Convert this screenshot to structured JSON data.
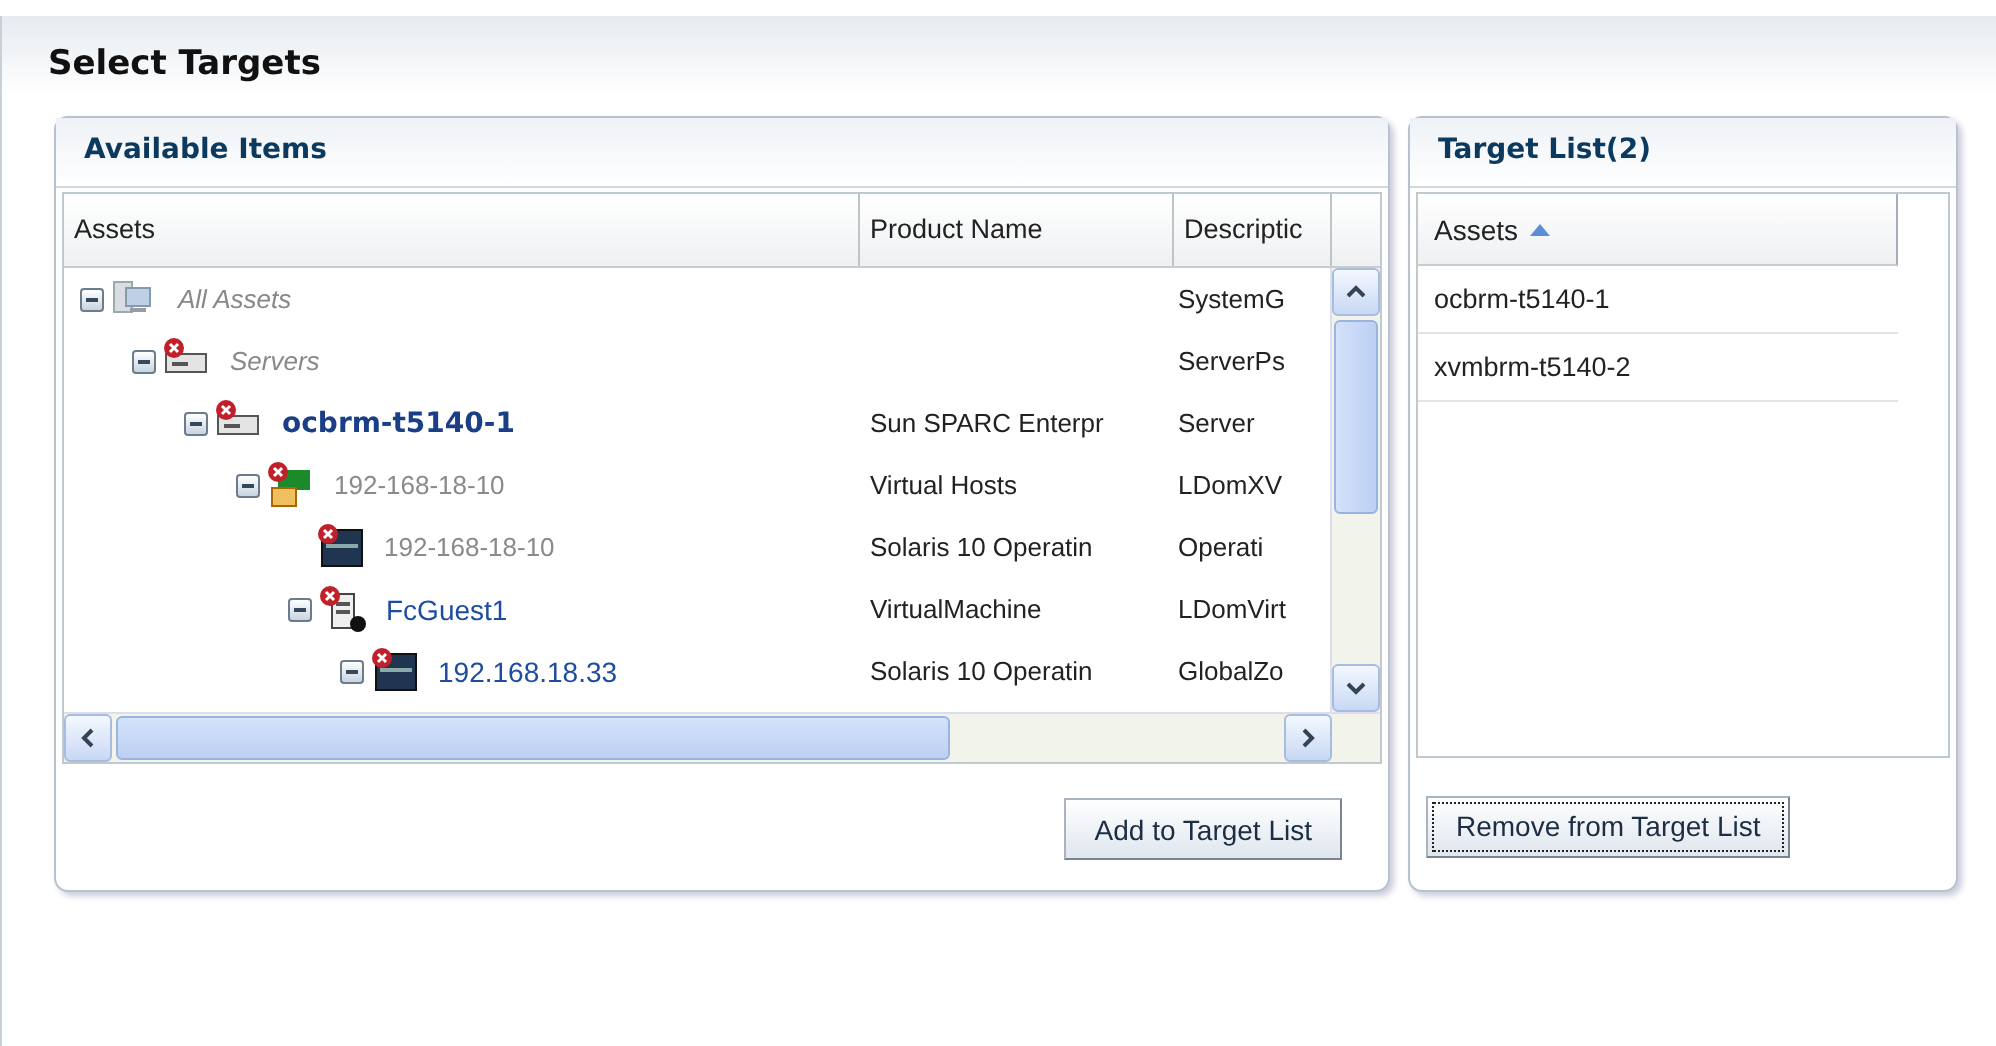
{
  "page_title": "Select Targets",
  "available": {
    "title": "Available Items",
    "columns": [
      "Assets",
      "Product Name",
      "Descriptic"
    ],
    "tree": [
      {
        "name": "All Assets",
        "kind": "root",
        "error": false,
        "expanded": true,
        "description": "SystemG",
        "children": [
          {
            "name": "Servers",
            "kind": "group",
            "error": true,
            "expanded": true,
            "description": "ServerPs",
            "children": [
              {
                "name": "ocbrm-t5140-1",
                "kind": "server",
                "error": true,
                "expanded": true,
                "product": "Sun SPARC Enterpr",
                "description": "Server",
                "children": [
                  {
                    "name": "192-168-18-10",
                    "kind": "vhost",
                    "error": true,
                    "expanded": true,
                    "product": "Virtual Hosts",
                    "description": "LDomXV",
                    "children": [
                      {
                        "name": "192-168-18-10",
                        "kind": "os",
                        "error": true,
                        "product": "Solaris 10 Operatin",
                        "description": "Operati"
                      },
                      {
                        "name": "FcGuest1",
                        "kind": "vm",
                        "error": true,
                        "expanded": true,
                        "product": "VirtualMachine",
                        "description": "LDomVirt",
                        "children": [
                          {
                            "name": "192.168.18.33",
                            "kind": "zone",
                            "error": true,
                            "expanded": true,
                            "product": "Solaris 10 Operatin",
                            "description": "GlobalZo"
                          }
                        ]
                      }
                    ]
                  }
                ]
              }
            ]
          }
        ]
      }
    ],
    "button": "Add to Target List"
  },
  "target": {
    "title": "Target List(2)",
    "column": "Assets",
    "sort_ascending": true,
    "rows": [
      "ocbrm-t5140-1",
      "xvmbrm-t5140-2"
    ],
    "button": "Remove from Target List",
    "button_focused": true
  }
}
